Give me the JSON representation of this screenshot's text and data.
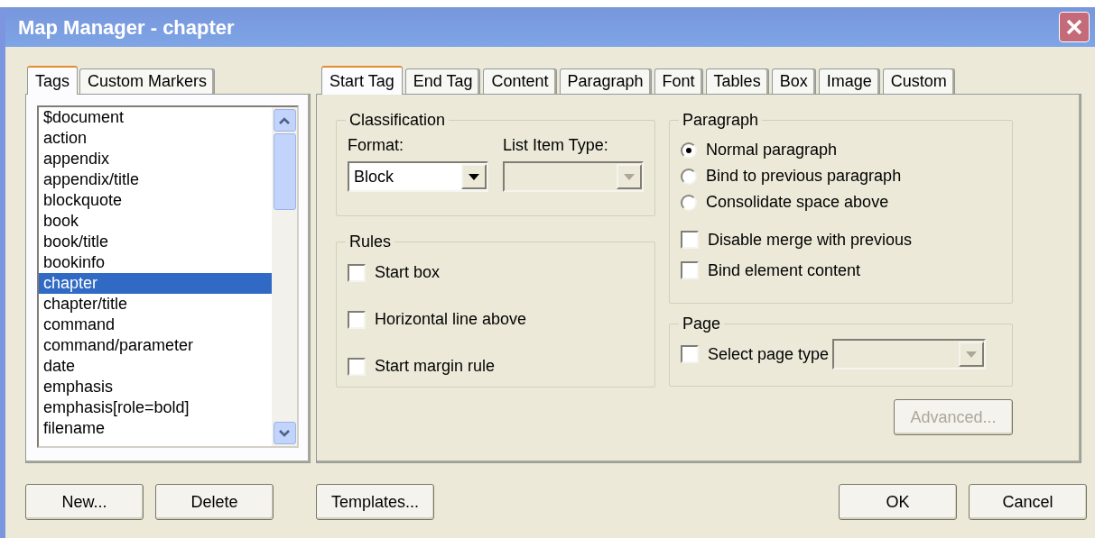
{
  "window": {
    "title": "Map Manager - chapter"
  },
  "left_tabs": [
    {
      "label": "Tags",
      "selected": true
    },
    {
      "label": "Custom Markers",
      "selected": false
    }
  ],
  "tags": [
    {
      "label": "$document",
      "selected": false
    },
    {
      "label": "action",
      "selected": false
    },
    {
      "label": "appendix",
      "selected": false
    },
    {
      "label": "appendix/title",
      "selected": false
    },
    {
      "label": "blockquote",
      "selected": false
    },
    {
      "label": "book",
      "selected": false
    },
    {
      "label": "book/title",
      "selected": false
    },
    {
      "label": "bookinfo",
      "selected": false
    },
    {
      "label": "chapter",
      "selected": true
    },
    {
      "label": "chapter/title",
      "selected": false
    },
    {
      "label": "command",
      "selected": false
    },
    {
      "label": "command/parameter",
      "selected": false
    },
    {
      "label": "date",
      "selected": false
    },
    {
      "label": "emphasis",
      "selected": false
    },
    {
      "label": "emphasis[role=bold]",
      "selected": false
    },
    {
      "label": "filename",
      "selected": false
    }
  ],
  "right_tabs": [
    {
      "label": "Start Tag",
      "selected": true
    },
    {
      "label": "End Tag",
      "selected": false
    },
    {
      "label": "Content",
      "selected": false
    },
    {
      "label": "Paragraph",
      "selected": false
    },
    {
      "label": "Font",
      "selected": false
    },
    {
      "label": "Tables",
      "selected": false
    },
    {
      "label": "Box",
      "selected": false
    },
    {
      "label": "Image",
      "selected": false
    },
    {
      "label": "Custom",
      "selected": false
    }
  ],
  "classification": {
    "label": "Classification",
    "format": {
      "label": "Format:",
      "value": "Block",
      "disabled": false
    },
    "list_item_type": {
      "label": "List Item Type:",
      "disabled": true
    }
  },
  "rules": {
    "label": "Rules",
    "options": [
      {
        "label": "Start box",
        "checked": false
      },
      {
        "label": "Horizontal line above",
        "checked": false
      },
      {
        "label": "Start margin rule",
        "checked": false
      }
    ]
  },
  "paragraph": {
    "label": "Paragraph",
    "options": [
      {
        "kind": "radio",
        "label": "Normal paragraph",
        "selected": true
      },
      {
        "kind": "radio",
        "label": "Bind to previous paragraph",
        "selected": false
      },
      {
        "kind": "radio",
        "label": "Consolidate space above",
        "selected": false
      },
      {
        "kind": "checkbox",
        "label": "Disable merge with previous",
        "checked": false
      },
      {
        "kind": "checkbox",
        "label": "Bind element content",
        "checked": false
      }
    ]
  },
  "page": {
    "label": "Page",
    "option": {
      "label": "Select page type",
      "checked": false
    },
    "page_type": {
      "disabled": true
    }
  },
  "advanced_button": {
    "label": "Advanced...",
    "disabled": true
  },
  "left_buttons": [
    "New...",
    "Delete"
  ],
  "templates_button": "Templates...",
  "dialog_buttons": [
    "OK",
    "Cancel"
  ]
}
